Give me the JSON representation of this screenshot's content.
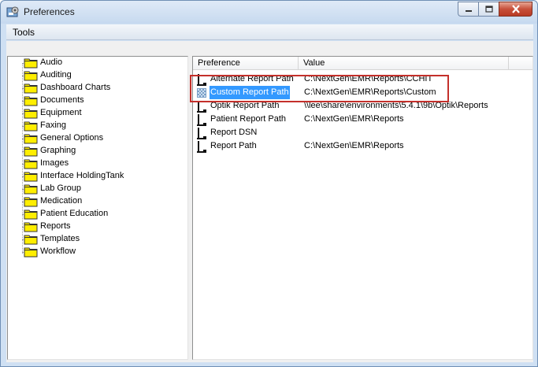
{
  "window": {
    "title": "Preferences"
  },
  "menu": {
    "tools": "Tools"
  },
  "tree": {
    "items": [
      {
        "label": "Audio"
      },
      {
        "label": "Auditing"
      },
      {
        "label": "Dashboard Charts"
      },
      {
        "label": "Documents"
      },
      {
        "label": "Equipment"
      },
      {
        "label": "Faxing"
      },
      {
        "label": "General Options"
      },
      {
        "label": "Graphing"
      },
      {
        "label": "Images"
      },
      {
        "label": "Interface HoldingTank"
      },
      {
        "label": "Lab Group"
      },
      {
        "label": "Medication"
      },
      {
        "label": "Patient Education"
      },
      {
        "label": "Reports"
      },
      {
        "label": "Templates"
      },
      {
        "label": "Workflow"
      }
    ]
  },
  "list": {
    "columns": {
      "preference": "Preference",
      "value": "Value"
    },
    "rows": [
      {
        "preference": "Alternate Report Path",
        "value": "C:\\NextGen\\EMR\\Reports\\CCHIT"
      },
      {
        "preference": "Custom Report Path",
        "value": "C:\\NextGen\\EMR\\Reports\\Custom",
        "selected": true
      },
      {
        "preference": "Optik Report Path",
        "value": "\\\\lee\\share\\environments\\5.4.1\\9b\\Optik\\Reports"
      },
      {
        "preference": "Patient Report Path",
        "value": "C:\\NextGen\\EMR\\Reports"
      },
      {
        "preference": "Report DSN",
        "value": ""
      },
      {
        "preference": "Report Path",
        "value": "C:\\NextGen\\EMR\\Reports"
      }
    ]
  },
  "colors": {
    "selection": "#3399ff",
    "highlight_box": "#c4302b",
    "folder": "#ffee00"
  }
}
